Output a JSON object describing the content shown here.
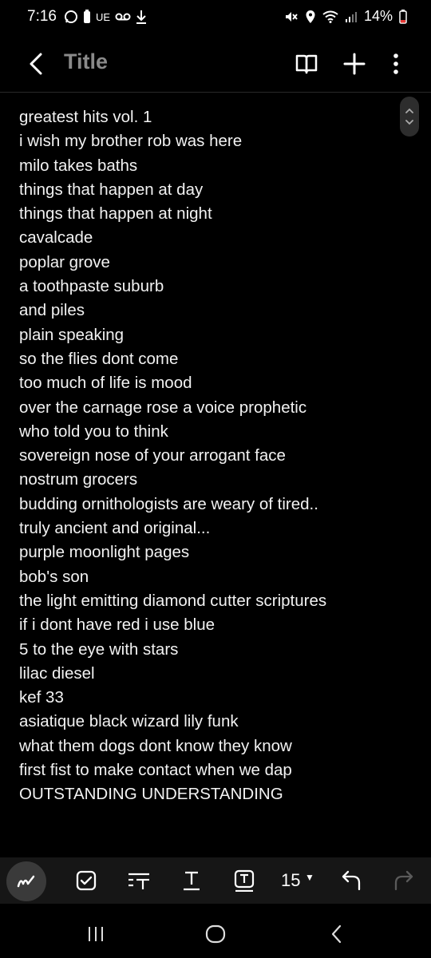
{
  "status": {
    "time": "7:16",
    "carrier_label": "UE",
    "battery": "14%"
  },
  "appbar": {
    "title": "Title",
    "icons": [
      "back-chevron-icon",
      "book-icon",
      "plus-icon",
      "more-vertical-icon"
    ]
  },
  "note": {
    "lines": [
      "greatest hits vol. 1",
      "i wish my brother rob was here",
      "milo takes baths",
      "things that happen at day",
      "things that happen at night",
      "cavalcade",
      "poplar grove",
      "a toothpaste suburb",
      "and piles",
      "plain speaking",
      "so the flies dont come",
      "too much of life is mood",
      "over the carnage rose a voice prophetic",
      "who told you to think",
      "sovereign nose of your arrogant face",
      "nostrum grocers",
      "budding ornithologists are weary of tired..",
      "truly ancient and original...",
      "purple moonlight pages",
      "bob's son",
      "the light emitting diamond cutter scriptures",
      "if i dont have red i use blue",
      "5 to the eye with stars",
      "lilac diesel",
      "kef 33",
      "asiatique black wizard lily funk",
      "what them dogs dont know they know",
      "first fist to make contact when we dap",
      "OUTSTANDING UNDERSTANDING"
    ]
  },
  "toolbar": {
    "font_size": "15",
    "icons": [
      "pen-icon",
      "checkbox-icon",
      "text-style-icon",
      "underline-text-icon",
      "text-box-icon",
      "undo-icon",
      "redo-icon"
    ]
  },
  "navbar": {
    "icons": [
      "recents-icon",
      "home-icon",
      "back-icon"
    ]
  }
}
